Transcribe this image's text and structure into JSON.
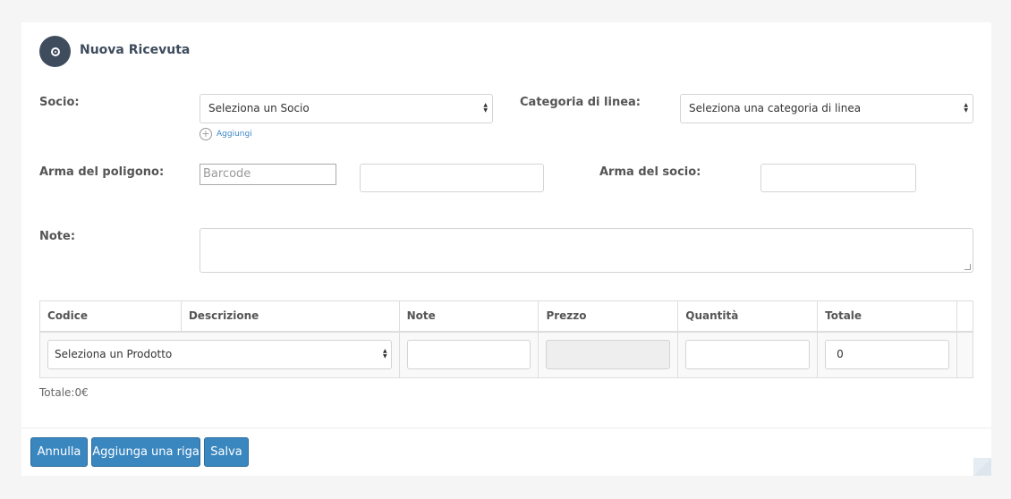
{
  "header": {
    "title": "Nuova Ricevuta",
    "icon": "circle-dot-icon"
  },
  "form": {
    "socio": {
      "label": "Socio:",
      "value": "Seleziona un Socio",
      "add_label": "Aggiungi"
    },
    "categoria": {
      "label": "Categoria di linea:",
      "value": "Seleziona una categoria di linea"
    },
    "arma_poligono": {
      "label": "Arma del poligono:",
      "barcode_placeholder": "Barcode",
      "value": ""
    },
    "arma_socio": {
      "label": "Arma del socio:",
      "value": ""
    },
    "note": {
      "label": "Note:",
      "value": ""
    }
  },
  "table": {
    "columns": [
      "Codice",
      "Descrizione",
      "Note",
      "Prezzo",
      "Quantità",
      "Totale"
    ],
    "rows": [
      {
        "product": "Seleziona un Prodotto",
        "note": "",
        "prezzo": "",
        "quantita": "",
        "totale": "0"
      }
    ]
  },
  "summary": {
    "total_text": "Totale:0€"
  },
  "footer": {
    "cancel_label": "Annulla",
    "add_row_label": "Aggiunga una riga",
    "save_label": "Salva"
  },
  "colors": {
    "primary_button": "#3a87c0",
    "header_icon": "#3e4c5e"
  }
}
